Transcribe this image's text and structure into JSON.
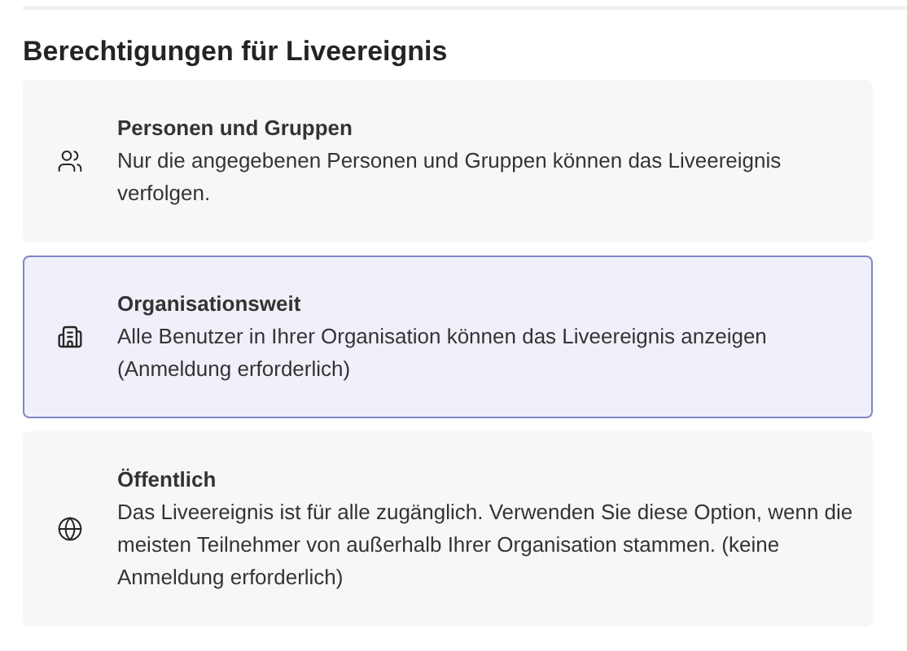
{
  "heading": "Berechtigungen für Liveereignis",
  "options": [
    {
      "kind": "people",
      "title": "Personen und Gruppen",
      "description": "Nur die angegebenen Personen und Gruppen können das Liveereignis verfolgen.",
      "selected": false
    },
    {
      "kind": "organization",
      "title": "Organisationsweit",
      "description": "Alle Benutzer in Ihrer Organisation können das Liveereignis anzeigen (Anmeldung erforderlich)",
      "selected": true
    },
    {
      "kind": "public",
      "title": "Öffentlich",
      "description": "Das Liveereignis ist für alle zugänglich. Verwenden Sie diese Option, wenn die meisten Teilnehmer von außerhalb Ihrer Organisation stammen. (keine Anmeldung erforderlich)",
      "selected": false
    }
  ]
}
